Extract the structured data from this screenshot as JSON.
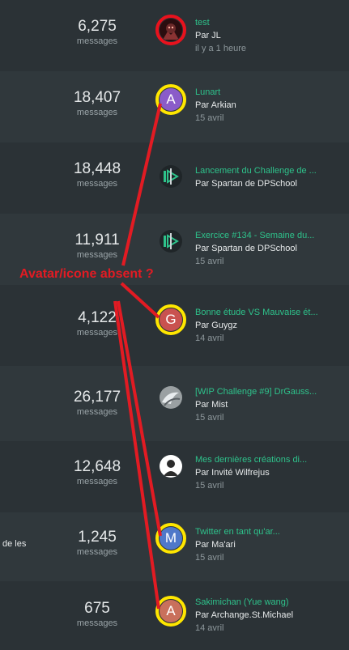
{
  "count_label": "messages",
  "annotation": "Avatar/icone absent ?",
  "side_text": "de les",
  "colors": {
    "accent_green": "#2ec28b",
    "highlight_yellow": "#ffe600",
    "annotation_red": "#e21b23"
  },
  "rows": [
    {
      "count": "6,275",
      "title": "test",
      "author": "Par JL",
      "date": "il y a 1 heure",
      "avatar": "dark-character-image",
      "ring": "red"
    },
    {
      "count": "18,407",
      "title": "Lunart",
      "author": "Par Arkian",
      "date": "15 avril",
      "avatar_letter": "A",
      "avatar_color": "#8a5cc9",
      "ring": "yellow"
    },
    {
      "count": "18,448",
      "title": "Lancement du Challenge de ...",
      "author": "Par Spartan de DPSchool",
      "date": "",
      "avatar": "dpschool-logo"
    },
    {
      "count": "11,911",
      "title": "Exercice #134 - Semaine du...",
      "author": "Par Spartan de DPSchool",
      "date": "15 avril",
      "avatar": "dpschool-logo"
    },
    {
      "count": "4,122",
      "title": "Bonne étude VS Mauvaise ét...",
      "author": "Par Guygz",
      "date": "14 avril",
      "avatar_letter": "G",
      "avatar_color": "#c9524f",
      "ring": "yellow"
    },
    {
      "count": "26,177",
      "title": "[WIP Challenge #9] DrGauss...",
      "author": "Par Mist",
      "date": "15 avril",
      "avatar": "grey-sketch-image"
    },
    {
      "count": "12,648",
      "title": "Mes dernières créations di...",
      "author": "Par Invité Wilfrejus",
      "date": "15 avril",
      "avatar": "default-user-silhouette"
    },
    {
      "count": "1,245",
      "title": "Twitter en tant qu'ar...",
      "author": "Par Ma'ari",
      "date": "15 avril",
      "avatar_letter": "M",
      "avatar_color": "#4f78c9",
      "ring": "yellow"
    },
    {
      "count": "675",
      "title": "Sakimichan (Yue wang)",
      "author": "Par Archange.St.Michael",
      "date": "14 avril",
      "avatar_letter": "A",
      "avatar_color": "#c9705c",
      "ring": "yellow"
    }
  ]
}
